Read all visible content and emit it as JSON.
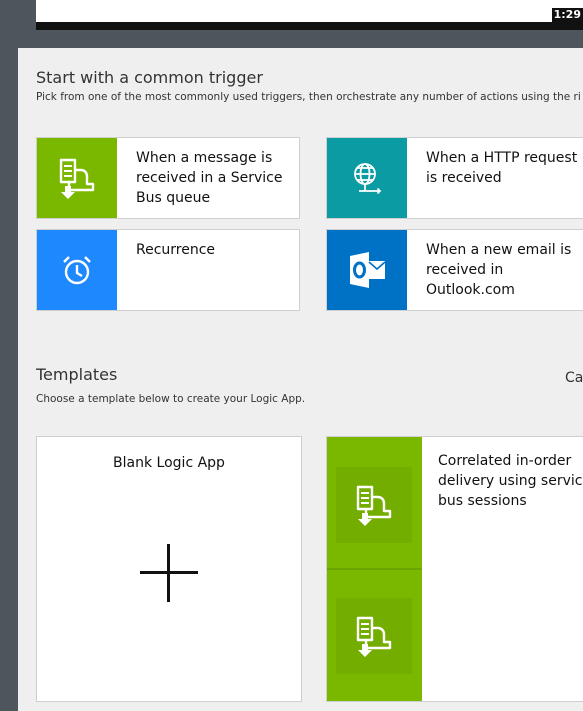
{
  "video": {
    "time": "1:29"
  },
  "trigger_section": {
    "title": "Start with a common trigger",
    "subtitle": "Pick from one of the most commonly used triggers, then orchestrate any number of actions using the ri"
  },
  "triggers": [
    {
      "label": "When a message is received in a Service Bus queue",
      "icon": "service-bus-icon",
      "color": "#7ab800"
    },
    {
      "label": "When a HTTP request is received",
      "icon": "http-globe-icon",
      "color": "#0b9ba3"
    },
    {
      "label": "Recurrence",
      "icon": "clock-icon",
      "color": "#1e88ff"
    },
    {
      "label": "When a new email is received in Outlook.com",
      "icon": "outlook-icon",
      "color": "#0072c6"
    }
  ],
  "templates_section": {
    "title": "Templates",
    "subtitle": "Choose a template below to create your Logic App.",
    "category_label": "Ca"
  },
  "templates": [
    {
      "label": "Blank Logic App"
    },
    {
      "label": "Correlated in-order delivery using service bus sessions",
      "icon": "service-bus-icon"
    }
  ]
}
